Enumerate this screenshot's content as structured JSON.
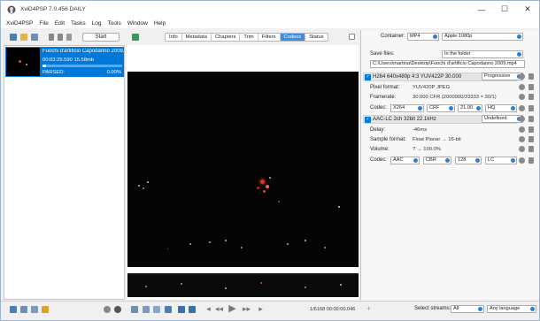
{
  "window": {
    "title": "XviD4PSP 7.0.456 DAILY",
    "controls": [
      "—",
      "☐",
      "✕"
    ]
  },
  "menu": [
    "XviD4PSP",
    "File",
    "Edit",
    "Tasks",
    "Log",
    "Tools",
    "Window",
    "Help"
  ],
  "toolbar": {
    "start_label": "Start"
  },
  "tabs": [
    "Info",
    "Metadata",
    "Chapters",
    "Trim",
    "Filters",
    "Codecs",
    "Status"
  ],
  "active_tab": "Codecs",
  "task": {
    "name": "Fuochi d'artificio Capodanno 2009...",
    "info": "00:03:25.590 15.58mb",
    "status": "PARSED:",
    "percent": "0.00%",
    "progress": 0.04
  },
  "output": {
    "container_label": "Container:",
    "container_value": "MP4",
    "preset_value": "Apple 1080p",
    "save_label": "Save files:",
    "save_value": "In the folder",
    "path": "C:\\Users\\martina\\Desktop\\Fuochi d'artificio Capodanno 2009.mp4"
  },
  "video_stream": {
    "header": "H264 640x480p 4:3 YUV422P 30.000",
    "profile": "Progressive",
    "pixel_label": "Pixel format:",
    "pixel_value": "YUV420P JPEG",
    "framerate_label": "Framerate:",
    "framerate_value": "30.000 CFR (2000000/33333 ≈ 30/1)",
    "codec_label": "Codec:",
    "codec": "X264",
    "mode": "CRF",
    "quality": "21.00",
    "preset": "HQ"
  },
  "audio_stream": {
    "header": "AAC-LC 2ch 32bit 22.1kHz",
    "language": "Undefined",
    "delay_label": "Delay:",
    "delay_value": "-46ms",
    "sample_label": "Sample format:",
    "sample_value": "Float Planar → 16-bit",
    "volume_label": "Volume:",
    "volume_value": "? → 100.0%",
    "codec_label": "Codec:",
    "codec": "AAC",
    "mode": "CBR",
    "bitrate": "128",
    "profile": "LC"
  },
  "status": {
    "timecode": "1/6168 00:00:00.046",
    "select_label": "Select streams:",
    "select_value": "All",
    "language_value": "Any language"
  },
  "colors": {
    "accent": "#0078d7",
    "tab_active": "#3b8fe0",
    "video_bg": "#050505"
  },
  "icons": [
    "app-icon",
    "add-icon",
    "open-folder-icon",
    "save-icon",
    "remove-icon",
    "trash-icon",
    "list-icon",
    "back-icon",
    "gear-icon",
    "play-icon"
  ]
}
